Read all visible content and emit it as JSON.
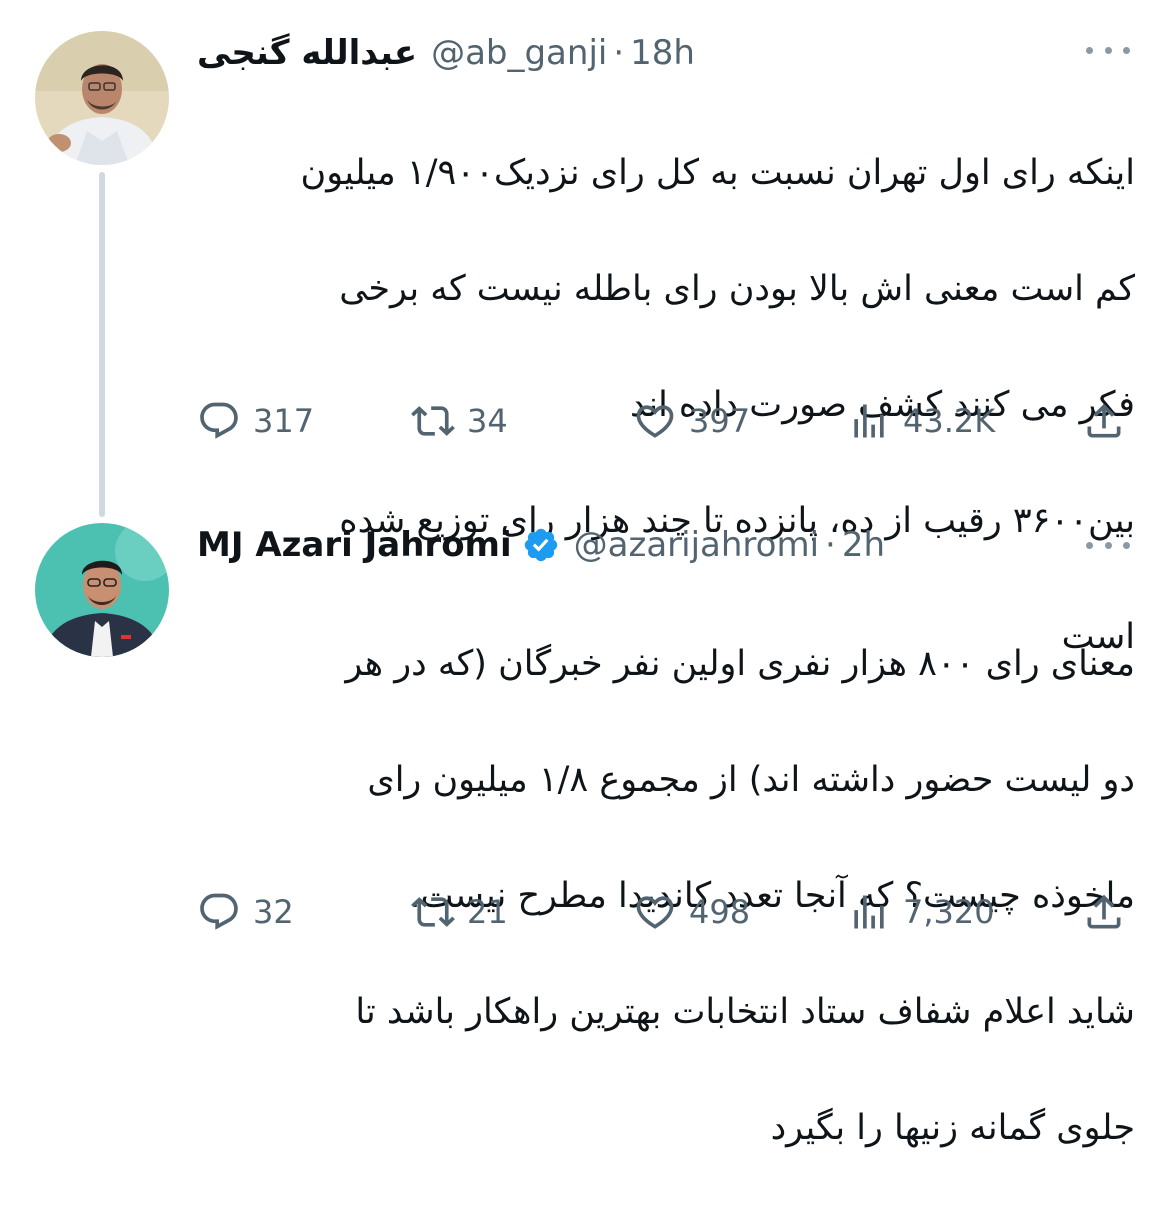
{
  "tweets": [
    {
      "author_name": "عبدالله گنجی",
      "handle": "@ab_ganji",
      "separator": "·",
      "time": "18h",
      "verified": false,
      "lines": [
        "اینکه رای اول تهران نسبت به کل رای نزدیک۱/۹۰۰ میلیون",
        "کم است معنی اش بالا بودن رای باطله نیست که برخی",
        "فکر می کنند کشف صورت داده اند",
        "بین۳۶۰۰ رقیب از ده، پانزده تا چند هزار رای توزیع شده",
        "است"
      ],
      "stats": {
        "replies": "317",
        "retweets": "34",
        "likes": "397",
        "views": "43.2K"
      }
    },
    {
      "author_name": "MJ Azari Jahromi",
      "handle": "@azarijahromi",
      "separator": "·",
      "time": "2h",
      "verified": true,
      "lines": [
        "معنای رای ۸۰۰ هزار نفری اولین نفر خبرگان (که در هر",
        "دو لیست حضور داشته اند) از مجموع ۱/۸ میلیون رای",
        "ماخوذه چیست؟ که آنجا تعدد کاندیدا مطرح نیست.",
        "شاید اعلام شفاف ستاد انتخابات بهترین راهکار باشد تا",
        "جلوی گمانه زنیها را بگیرد"
      ],
      "stats": {
        "replies": "32",
        "retweets": "21",
        "likes": "498",
        "views": "7,320"
      }
    }
  ],
  "icons": {
    "reply": "reply-icon",
    "retweet": "retweet-icon",
    "like": "heart-icon",
    "views": "views-icon",
    "share": "share-icon",
    "more": "more-icon",
    "verified": "verified-badge-icon"
  },
  "colors": {
    "text": "#0f1419",
    "muted": "#536471",
    "verified": "#1d9bf0",
    "thread_line": "#cfd9de"
  }
}
